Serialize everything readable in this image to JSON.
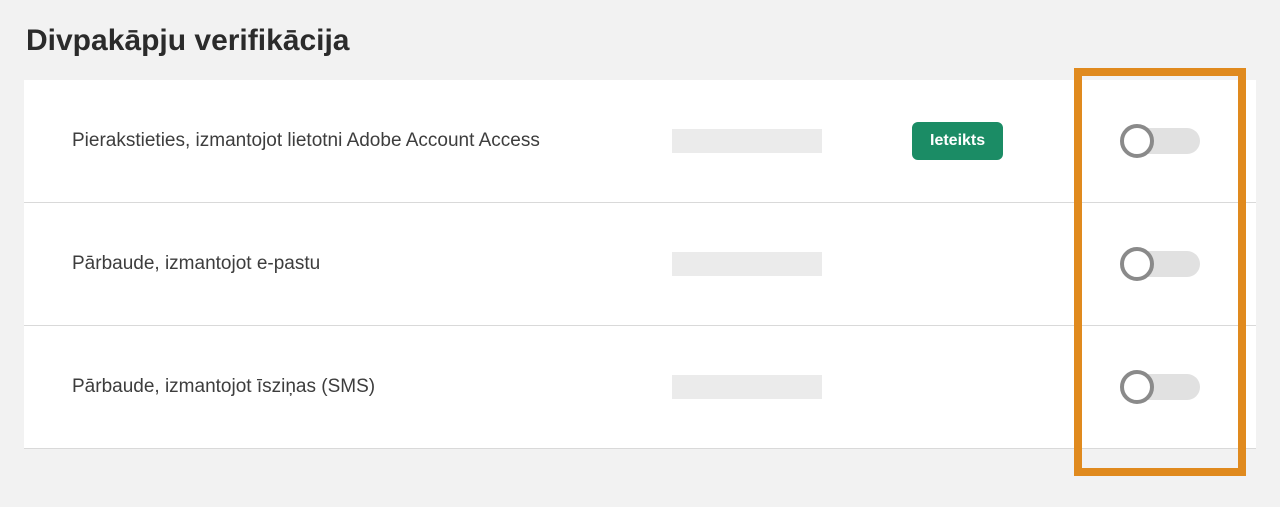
{
  "section": {
    "title": "Divpakāpju verifikācija"
  },
  "rows": [
    {
      "label": "Pierakstieties, izmantojot lietotni Adobe Account Access",
      "badge": "Ieteikts",
      "has_badge": true,
      "toggle_on": false
    },
    {
      "label": "Pārbaude, izmantojot e-pastu",
      "has_badge": false,
      "toggle_on": false
    },
    {
      "label": "Pārbaude, izmantojot īsziņas (SMS)",
      "has_badge": false,
      "toggle_on": false
    }
  ],
  "colors": {
    "badge_bg": "#1b8c65",
    "highlight": "#e08a1e"
  }
}
